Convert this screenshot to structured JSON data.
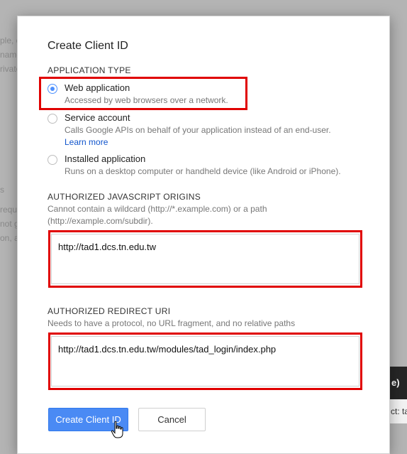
{
  "background": {
    "left_fragments": [
      "ple, c",
      "name",
      "rivate",
      "s",
      "requ",
      "not g",
      "on, a"
    ],
    "right_panel_text": "e)",
    "right_panel_subtext": "ct: ta"
  },
  "dialog": {
    "title": "Create Client ID",
    "application_type": {
      "label": "APPLICATION TYPE",
      "options": [
        {
          "label": "Web application",
          "description": "Accessed by web browsers over a network.",
          "selected": true
        },
        {
          "label": "Service account",
          "description": "Calls Google APIs on behalf of your application instead of an end-user.",
          "link": "Learn more",
          "selected": false
        },
        {
          "label": "Installed application",
          "description": "Runs on a desktop computer or handheld device (like Android or iPhone).",
          "selected": false
        }
      ]
    },
    "js_origins": {
      "label": "AUTHORIZED JAVASCRIPT ORIGINS",
      "help_line1": "Cannot contain a wildcard (http://*.example.com) or a path",
      "help_line2": "(http://example.com/subdir).",
      "value": "http://tad1.dcs.tn.edu.tw"
    },
    "redirect_uri": {
      "label": "AUTHORIZED REDIRECT URI",
      "help": "Needs to have a protocol, no URL fragment, and no relative paths",
      "value": "http://tad1.dcs.tn.edu.tw/modules/tad_login/index.php"
    },
    "buttons": {
      "create": "Create Client ID",
      "cancel": "Cancel"
    }
  },
  "colors": {
    "accent": "#4a8af4",
    "highlight": "#e00000",
    "link": "#1155cc"
  }
}
